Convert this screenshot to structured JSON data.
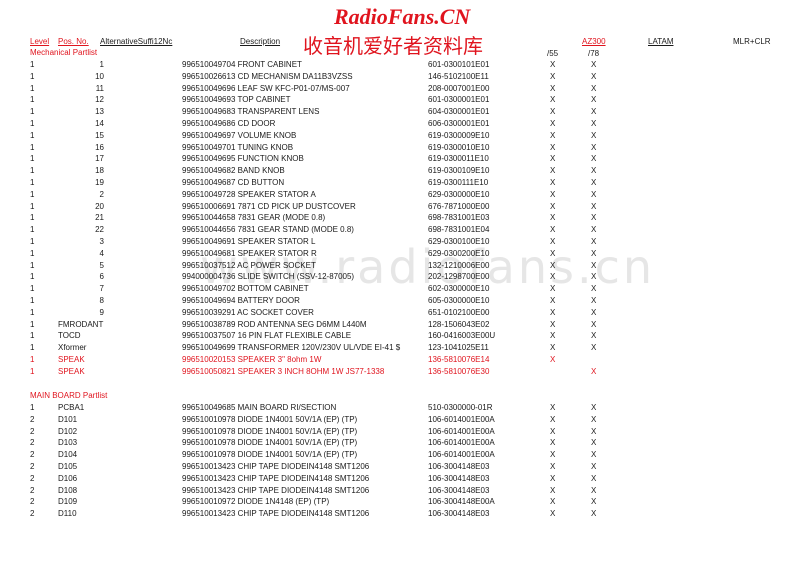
{
  "watermark": {
    "title": "RadioFans.CN",
    "chinese": "收音机爱好者资料库",
    "background": "www.radiofans.cn"
  },
  "header": {
    "level": "Level",
    "pos_no": "Pos. No.",
    "alternative": "AlternativeSuffi12Nc",
    "description": "Description",
    "az300": "AZ300",
    "latam": "LATAM",
    "mlr_clr": "MLR+CLR",
    "sub1": "/55",
    "sub2": "/78"
  },
  "mechanical": {
    "title": "Mechanical Partlist",
    "rows": [
      {
        "level": "1",
        "pos": "1",
        "desc": "996510049704 FRONT CABINET",
        "code": "601-0300101E01",
        "x1": "X",
        "x2": "X"
      },
      {
        "level": "1",
        "pos": "10",
        "desc": "996510026613 CD MECHANISM DA11B3VZSS",
        "code": "146-5102100E11",
        "x1": "X",
        "x2": "X"
      },
      {
        "level": "1",
        "pos": "11",
        "desc": "996510049696 LEAF SW KFC-P01-07/MS-007",
        "code": "208-0007001E00",
        "x1": "X",
        "x2": "X"
      },
      {
        "level": "1",
        "pos": "12",
        "desc": "996510049693 TOP CABINET",
        "code": "601-0300001E01",
        "x1": "X",
        "x2": "X"
      },
      {
        "level": "1",
        "pos": "13",
        "desc": "996510049683 TRANSPARENT LENS",
        "code": "604-0300001E01",
        "x1": "X",
        "x2": "X"
      },
      {
        "level": "1",
        "pos": "14",
        "desc": "996510049686 CD DOOR",
        "code": "606-0300001E01",
        "x1": "X",
        "x2": "X"
      },
      {
        "level": "1",
        "pos": "15",
        "desc": "996510049697 VOLUME KNOB",
        "code": "619-0300009E10",
        "x1": "X",
        "x2": "X"
      },
      {
        "level": "1",
        "pos": "16",
        "desc": "996510049701 TUNING KNOB",
        "code": "619-0300010E10",
        "x1": "X",
        "x2": "X"
      },
      {
        "level": "1",
        "pos": "17",
        "desc": "996510049695 FUNCTION KNOB",
        "code": "619-0300011E10",
        "x1": "X",
        "x2": "X"
      },
      {
        "level": "1",
        "pos": "18",
        "desc": "996510049682 BAND KNOB",
        "code": "619-0300109E10",
        "x1": "X",
        "x2": "X"
      },
      {
        "level": "1",
        "pos": "19",
        "desc": "996510049687 CD BUTTON",
        "code": "619-0300111E10",
        "x1": "X",
        "x2": "X"
      },
      {
        "level": "1",
        "pos": "2",
        "desc": "996510049728 SPEAKER STATOR A",
        "code": "629-0300000E10",
        "x1": "X",
        "x2": "X"
      },
      {
        "level": "1",
        "pos": "20",
        "desc": "996510006691 7871 CD PICK UP DUSTCOVER",
        "code": "676-7871000E00",
        "x1": "X",
        "x2": "X"
      },
      {
        "level": "1",
        "pos": "21",
        "desc": "996510044658 7831 GEAR (MODE 0.8)",
        "code": "698-7831001E03",
        "x1": "X",
        "x2": "X"
      },
      {
        "level": "1",
        "pos": "22",
        "desc": "996510044656 7831 GEAR STAND (MODE 0.8)",
        "code": "698-7831001E04",
        "x1": "X",
        "x2": "X"
      },
      {
        "level": "1",
        "pos": "3",
        "desc": "996510049691 SPEAKER STATOR L",
        "code": "629-0300100E10",
        "x1": "X",
        "x2": "X"
      },
      {
        "level": "1",
        "pos": "4",
        "desc": "996510049681 SPEAKER STATOR R",
        "code": "629-0300200E10",
        "x1": "X",
        "x2": "X"
      },
      {
        "level": "1",
        "pos": "5",
        "desc": "996510037512 AC POWER SOCKET",
        "code": "132-1210006E00",
        "x1": "X",
        "x2": "X"
      },
      {
        "level": "1",
        "pos": "6",
        "desc": "994000004736 SLIDE SWITCH (SSV-12-87005)",
        "code": "202-1298700E00",
        "x1": "X",
        "x2": "X"
      },
      {
        "level": "1",
        "pos": "7",
        "desc": "996510049702 BOTTOM CABINET",
        "code": "602-0300000E10",
        "x1": "X",
        "x2": "X"
      },
      {
        "level": "1",
        "pos": "8",
        "desc": "996510049694 BATTERY DOOR",
        "code": "605-0300000E10",
        "x1": "X",
        "x2": "X"
      },
      {
        "level": "1",
        "pos": "9",
        "desc": "996510039291 AC SOCKET COVER",
        "code": "651-0102100E00",
        "x1": "X",
        "x2": "X"
      },
      {
        "level": "1",
        "pos": "FMRODANT",
        "desc": "996510038789 ROD ANTENNA SEG D6MM L440M",
        "code": "128-1506043E02",
        "x1": "X",
        "x2": "X"
      },
      {
        "level": "1",
        "pos": "TOCD",
        "desc": "996510037507 16 PIN FLAT FLEXIBLE CABLE",
        "code": "160-0416003E00U",
        "x1": "X",
        "x2": "X"
      },
      {
        "level": "1",
        "pos": "Xformer",
        "desc": "996510049699 TRANSFORMER 120V/230V UL/VDE EI-41   $",
        "code": "123-1041025E11",
        "x1": "X",
        "x2": "X"
      },
      {
        "level": "1",
        "pos": "SPEAK",
        "desc": "996510020153 SPEAKER 3\" 8ohm 1W",
        "code": "136-5810076E14",
        "x1": "X",
        "x2": "",
        "red": true
      },
      {
        "level": "1",
        "pos": "SPEAK",
        "desc": "996510050821 SPEAKER 3 INCH 8OHM 1W JS77-1338",
        "code": "136-5810076E30",
        "x1": "",
        "x2": "X",
        "red": true
      }
    ]
  },
  "mainboard": {
    "title": "MAIN BOARD Partlist",
    "rows": [
      {
        "level": "1",
        "pos": "PCBA1",
        "desc": "996510049685 MAIN BOARD RI/SECTION",
        "code": "510-0300000-01R",
        "x1": "X",
        "x2": "X"
      },
      {
        "level": "2",
        "pos": "D101",
        "desc": "996510010978 DIODE 1N4001 50V/1A  (EP) (TP)",
        "code": "106-6014001E00A",
        "x1": "X",
        "x2": "X"
      },
      {
        "level": "2",
        "pos": "D102",
        "desc": "996510010978 DIODE 1N4001 50V/1A  (EP) (TP)",
        "code": "106-6014001E00A",
        "x1": "X",
        "x2": "X"
      },
      {
        "level": "2",
        "pos": "D103",
        "desc": "996510010978 DIODE 1N4001 50V/1A  (EP) (TP)",
        "code": "106-6014001E00A",
        "x1": "X",
        "x2": "X"
      },
      {
        "level": "2",
        "pos": "D104",
        "desc": "996510010978 DIODE 1N4001 50V/1A  (EP) (TP)",
        "code": "106-6014001E00A",
        "x1": "X",
        "x2": "X"
      },
      {
        "level": "2",
        "pos": "D105",
        "desc": "996510013423 CHIP TAPE DIODEIN4148 SMT1206",
        "code": "106-3004148E03",
        "x1": "X",
        "x2": "X"
      },
      {
        "level": "2",
        "pos": "D106",
        "desc": "996510013423 CHIP TAPE DIODEIN4148 SMT1206",
        "code": "106-3004148E03",
        "x1": "X",
        "x2": "X"
      },
      {
        "level": "2",
        "pos": "D108",
        "desc": "996510013423 CHIP TAPE DIODEIN4148 SMT1206",
        "code": "106-3004148E03",
        "x1": "X",
        "x2": "X"
      },
      {
        "level": "2",
        "pos": "D109",
        "desc": "996510010972 DIODE 1N4148 (EP) (TP)",
        "code": "106-3004148E00A",
        "x1": "X",
        "x2": "X"
      },
      {
        "level": "2",
        "pos": "D110",
        "desc": "996510013423 CHIP TAPE DIODEIN4148 SMT1206",
        "code": "106-3004148E03",
        "x1": "X",
        "x2": "X"
      }
    ]
  }
}
